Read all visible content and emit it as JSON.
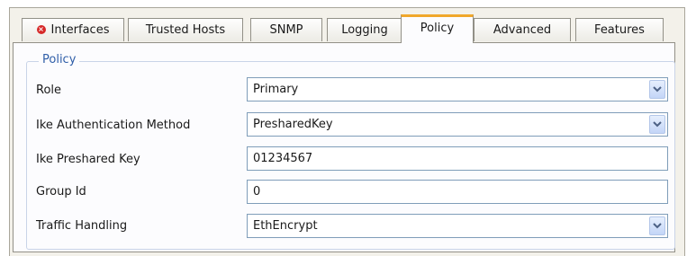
{
  "tabs": [
    {
      "label": "Interfaces",
      "icon": "error-icon"
    },
    {
      "label": "Trusted Hosts"
    },
    {
      "label": "SNMP"
    },
    {
      "label": "Logging"
    },
    {
      "label": "Policy",
      "active": true
    },
    {
      "label": "Advanced"
    },
    {
      "label": "Features"
    }
  ],
  "accent_color": "#f0a72b",
  "group_title_color": "#2f5ea8",
  "policy": {
    "group_title": "Policy",
    "rows": [
      {
        "label": "Role",
        "value": "Primary",
        "type": "select"
      },
      {
        "label": "Ike Authentication Method",
        "value": "PresharedKey",
        "type": "select"
      },
      {
        "label": "Ike Preshared Key",
        "value": "01234567",
        "type": "text"
      },
      {
        "label": "Group Id",
        "value": "0",
        "type": "text"
      },
      {
        "label": "Traffic Handling",
        "value": "EthEncrypt",
        "type": "select"
      }
    ]
  }
}
